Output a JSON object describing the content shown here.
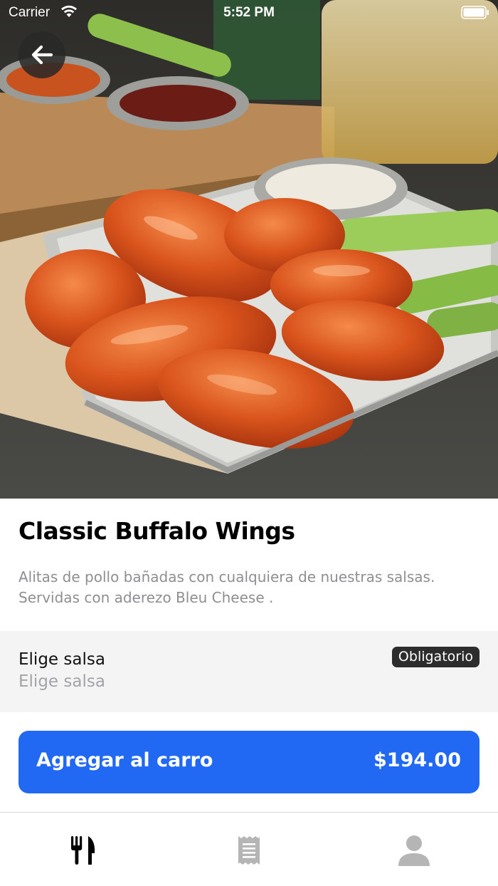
{
  "status_bar": {
    "carrier": "Carrier",
    "time": "5:52 PM"
  },
  "hero": {
    "image_subject": "buffalo-wings-photo"
  },
  "product": {
    "title": "Classic Buffalo Wings",
    "description": "Alitas de pollo bañadas con cualquiera de nuestras salsas. Servidas con aderezo Bleu Cheese ."
  },
  "option": {
    "label": "Elige salsa",
    "placeholder": "Elige salsa",
    "badge": "Obligatorio"
  },
  "cart_button": {
    "label": "Agregar al carro",
    "price": "$194.00",
    "color": "#2169f3"
  },
  "tab_bar": {
    "tabs": [
      {
        "icon": "fork-knife-icon",
        "active": true
      },
      {
        "icon": "receipt-icon",
        "active": false
      },
      {
        "icon": "person-icon",
        "active": false
      }
    ],
    "active_color": "#000000",
    "inactive_color": "#b5b5b5"
  }
}
